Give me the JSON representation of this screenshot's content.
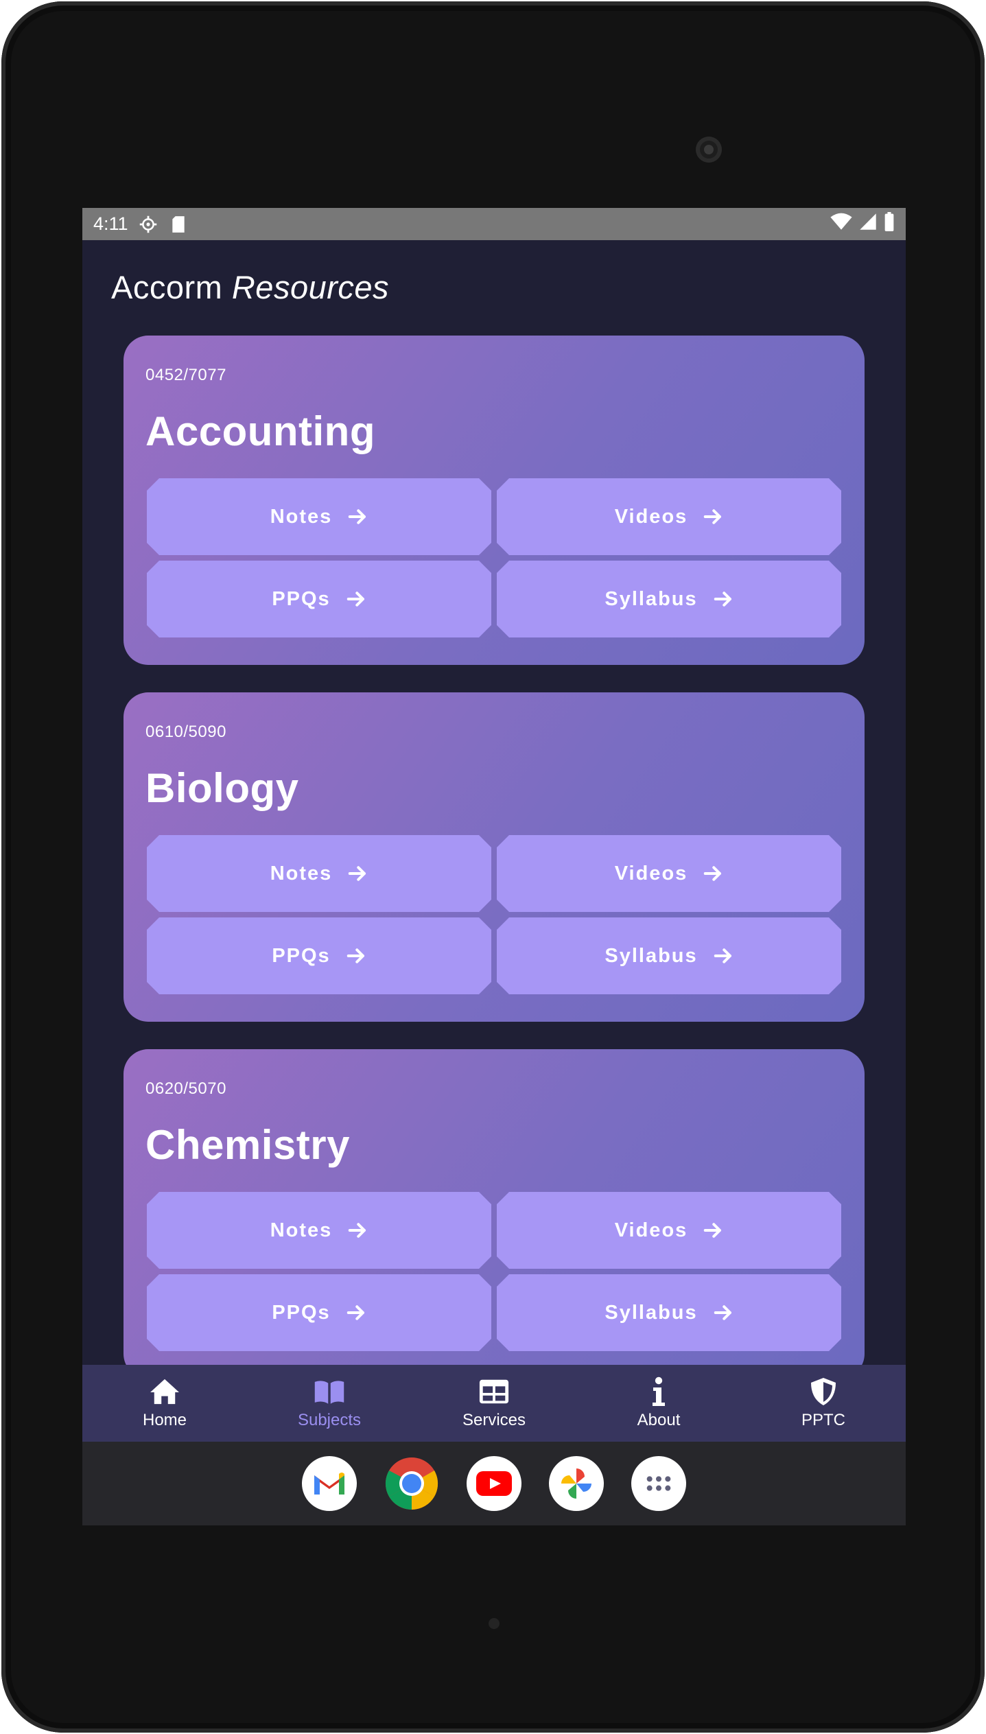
{
  "status_bar": {
    "time": "4:11",
    "icons": [
      "settings-gear-icon",
      "sd-card-icon",
      "wifi-icon",
      "cellular-signal-icon",
      "battery-icon"
    ]
  },
  "app": {
    "title_plain": "Accorm",
    "title_italic": "Resources"
  },
  "colors": {
    "screen_bg": "#1f1f35",
    "card_gradient_start": "#9a6fc3",
    "card_gradient_end": "#6c6ac0",
    "button_bg": "#a796f5",
    "bottom_nav_bg": "#37355e",
    "nav_active": "#9b8ff0"
  },
  "cards": [
    {
      "code": "0452/7077",
      "subject": "Accounting",
      "buttons": {
        "notes": "Notes",
        "videos": "Videos",
        "ppqs": "PPQs",
        "syllabus": "Syllabus"
      }
    },
    {
      "code": "0610/5090",
      "subject": "Biology",
      "buttons": {
        "notes": "Notes",
        "videos": "Videos",
        "ppqs": "PPQs",
        "syllabus": "Syllabus"
      }
    },
    {
      "code": "0620/5070",
      "subject": "Chemistry",
      "buttons": {
        "notes": "Notes",
        "videos": "Videos",
        "ppqs": "PPQs",
        "syllabus": "Syllabus"
      }
    }
  ],
  "bottom_nav": [
    {
      "label": "Home",
      "icon": "home-icon",
      "active": false
    },
    {
      "label": "Subjects",
      "icon": "book-icon",
      "active": true
    },
    {
      "label": "Services",
      "icon": "table-grid-icon",
      "active": false
    },
    {
      "label": "About",
      "icon": "info-icon",
      "active": false
    },
    {
      "label": "PPTC",
      "icon": "shield-icon",
      "active": false
    }
  ],
  "dock": [
    "gmail-icon",
    "chrome-icon",
    "youtube-icon",
    "photos-icon",
    "app-drawer-icon"
  ]
}
